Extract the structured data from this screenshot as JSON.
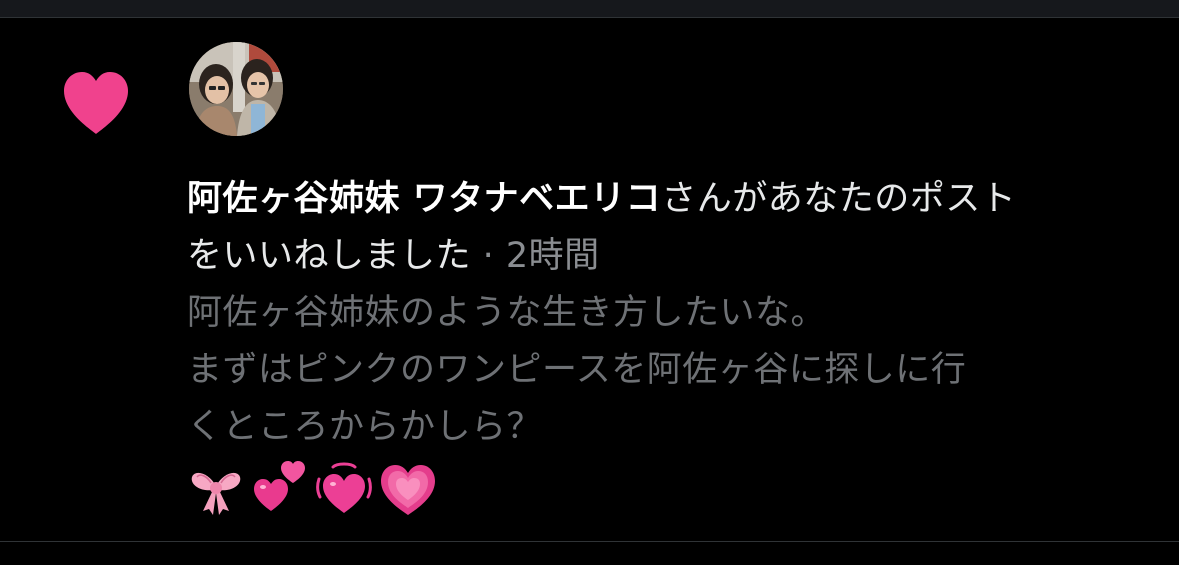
{
  "notification": {
    "type": "like",
    "like_color": "#f91880",
    "user_name": "阿佐ヶ谷姉妹 ワタナベエリコ",
    "action_text": "さんがあなたのポスト",
    "action_text_cont": "をいいねしました",
    "separator": " · ",
    "time_ago": "2時間",
    "post_preview": {
      "line1": "阿佐ヶ谷姉妹のような生き方したいな。",
      "line2": "まずはピンクのワンピースを阿佐ヶ谷に探しに行",
      "line3": "くところからかしら？",
      "emojis": [
        "ribbon",
        "two-hearts",
        "beating-heart",
        "growing-heart"
      ]
    }
  }
}
